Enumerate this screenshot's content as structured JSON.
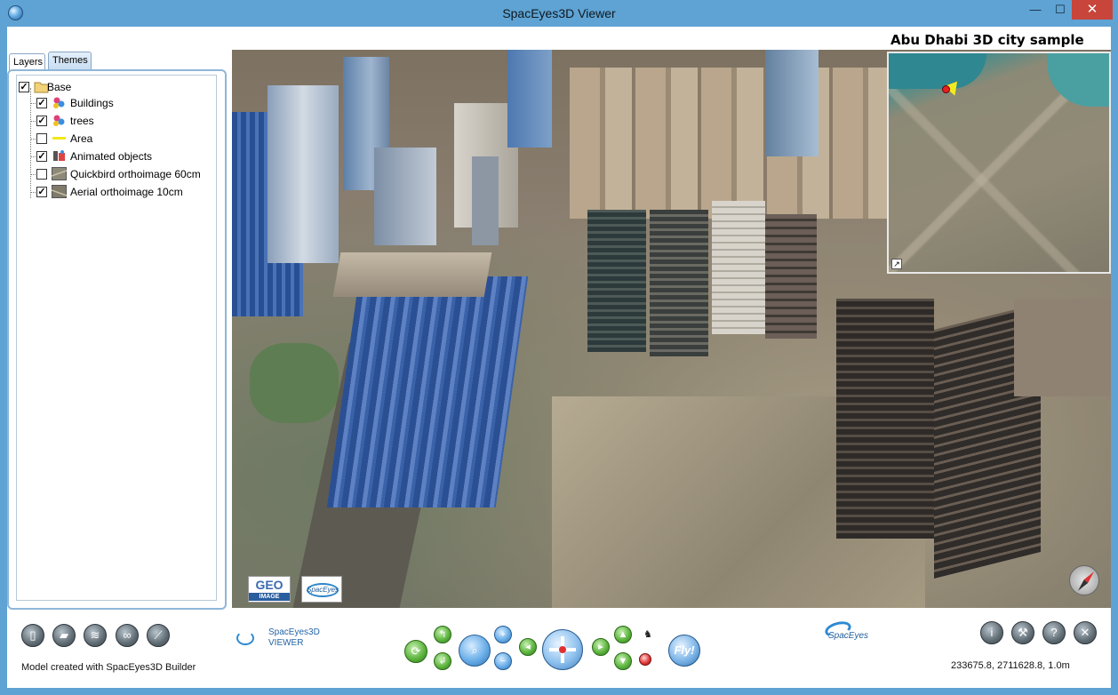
{
  "window": {
    "title": "SpacEyes3D Viewer",
    "controls": {
      "minimize": "—",
      "maximize": "☐",
      "close": "✕"
    }
  },
  "tabs": [
    {
      "label": "Layers",
      "active": true
    },
    {
      "label": "Themes",
      "active": false
    }
  ],
  "layers": [
    {
      "label": "Base",
      "checked": true,
      "icon": "folder-icon"
    },
    {
      "label": "Buildings",
      "checked": true,
      "icon": "buildings-layer-icon"
    },
    {
      "label": "trees",
      "checked": true,
      "icon": "trees-layer-icon"
    },
    {
      "label": "Area",
      "checked": false,
      "icon": "area-line-icon"
    },
    {
      "label": "Animated objects",
      "checked": true,
      "icon": "animated-objects-icon"
    },
    {
      "label": "Quickbird orthoimage 60cm",
      "checked": false,
      "icon": "raster-image-icon"
    },
    {
      "label": "Aerial orthoimage 10cm",
      "checked": true,
      "icon": "raster-image-icon"
    }
  ],
  "view": {
    "overlay_title": "Abu Dhabi 3D city sample",
    "logo_geo": "GEO",
    "logo_geo_sub": "IMAGE",
    "logo_spaceyes": "SpacEyes"
  },
  "toolbar": {
    "fly_label": "Fly!",
    "brand_text_line1": "SpacEyes3D",
    "brand_text_line2": "VIEWER",
    "brand_logo": "SpacEyes"
  },
  "status": {
    "left": "Model created with SpacEyes3D Builder",
    "right": "233675.8, 2711628.8, 1.0m"
  },
  "colors": {
    "titlebar": "#5ea3d3",
    "close_button": "#c7453b",
    "panel_border": "#8fb6d8"
  }
}
